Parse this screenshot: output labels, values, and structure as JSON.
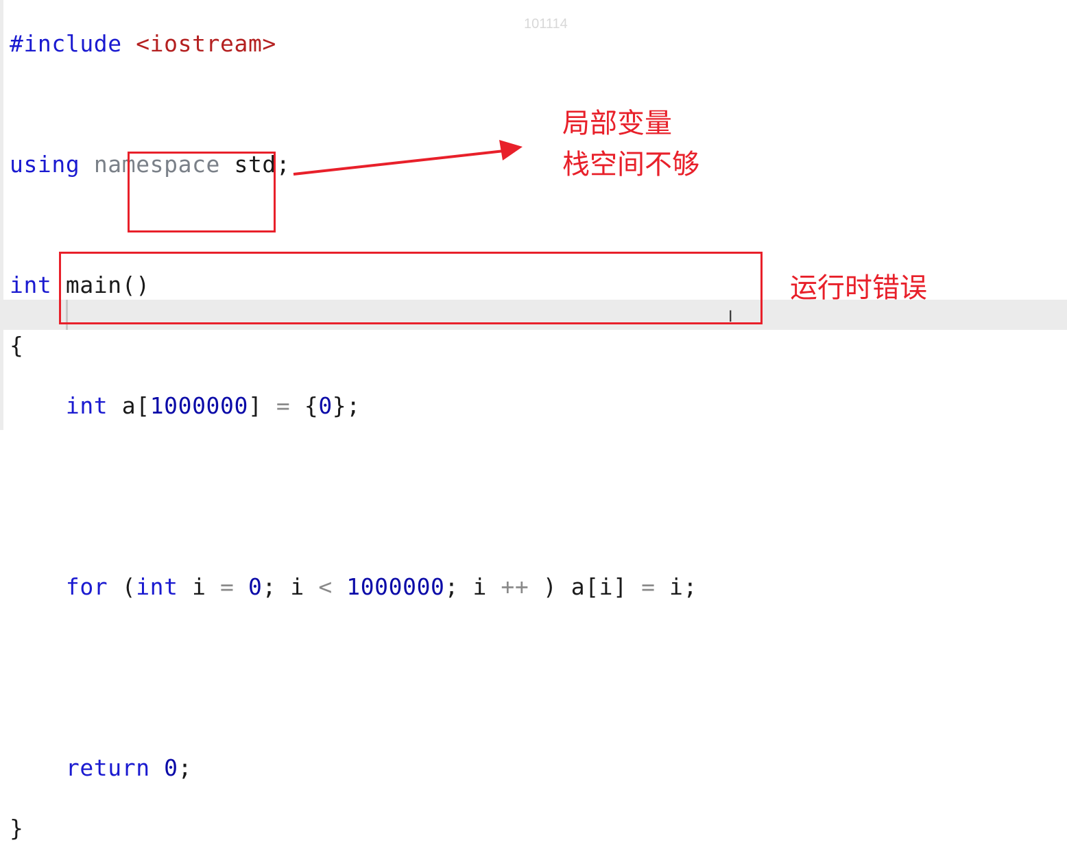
{
  "watermark": "101114",
  "code": {
    "l1_kw": "#include",
    "l1_str": "<iostream>",
    "l3_kw": "using",
    "l3_ns": "namespace",
    "l3_rest": "std;",
    "l5_kw": "int",
    "l5_rest": "main()",
    "l6": "{",
    "l7_kw": "int",
    "l7_a": "a[",
    "l7_num": "1000000",
    "l7_b": "]",
    "l7_eq": "=",
    "l7_c": "{",
    "l7_zero": "0",
    "l7_d": "};",
    "l10_for": "for",
    "l10_p": "(",
    "l10_int": "int",
    "l10_i": "i",
    "l10_eq": "=",
    "l10_zero": "0",
    "l10_s1": "; i",
    "l10_lt": "<",
    "l10_num": "1000000",
    "l10_s2": "; i",
    "l10_pp": "++",
    "l10_rest": ") a[i]",
    "l10_eq2": "=",
    "l10_end": "i;",
    "l13_kw": "return",
    "l13_zero": "0",
    "l13_end": ";",
    "l14": "}"
  },
  "annotations": {
    "note1_line1": "局部变量",
    "note1_line2": "栈空间不够",
    "note2": "运行时错误",
    "color": "#e8202a"
  }
}
